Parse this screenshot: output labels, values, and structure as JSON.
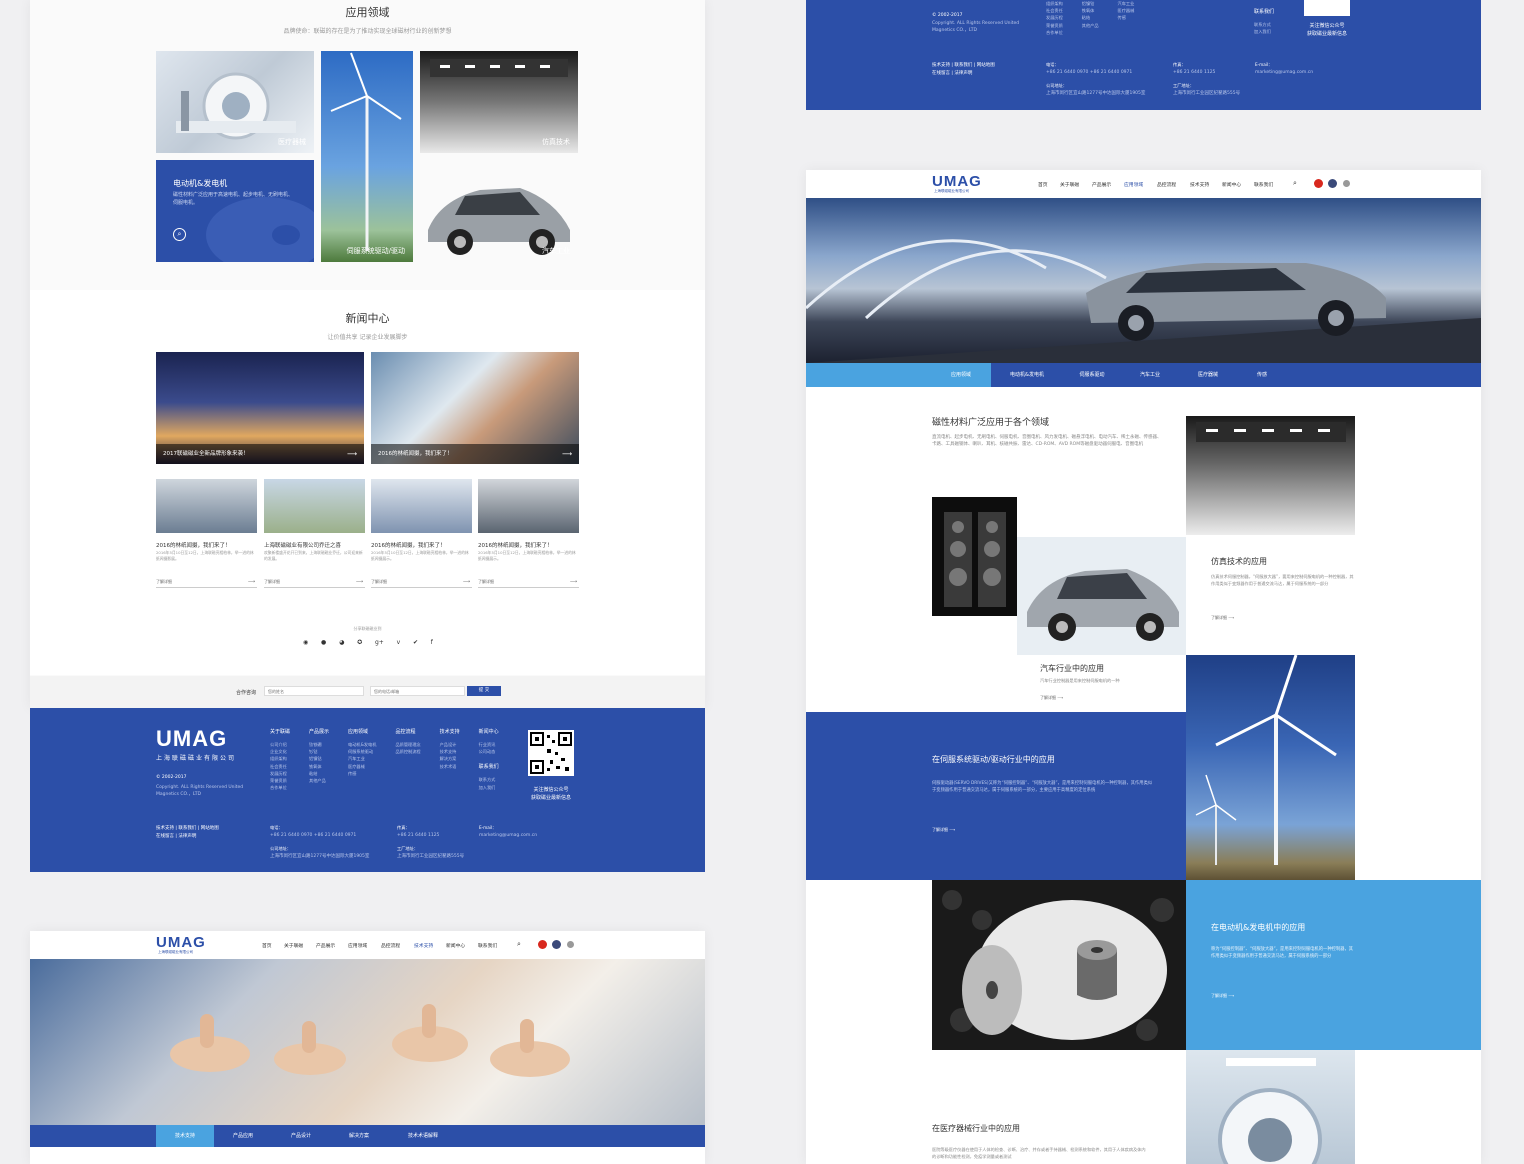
{
  "home": {
    "apps_title": "应用领域",
    "apps_subtitle": "品牌使命：联磁的存在是为了推动实现全球磁材行业的创新梦想",
    "tiles": [
      {
        "label": "医疗器械"
      },
      {
        "label": "伺服系统驱动/驱动"
      },
      {
        "label": "仿真技术"
      },
      {
        "label": "汽车工业"
      }
    ],
    "feature_tile": {
      "title": "电动机&发电机",
      "text": "磁性材料广泛应用于高速电机、起步电机、无刷电机、伺服电机。"
    },
    "news_title": "新闻中心",
    "news_subtitle": "让价值共享 记录企业发展脚步",
    "news_big": [
      {
        "title": "2017联磁磁业全新品牌形象来袭！"
      },
      {
        "title": "2016的林纸闻摄，我们来了！"
      }
    ],
    "news_small": [
      {
        "title": "2016的林纸闻摄，我们来了！",
        "desc": "2016年5月10日至12日，上海联磁亮相柏林，举一进的林纸闻摄影展。",
        "more": "了解详细"
      },
      {
        "title": "上海联磁磁业有限公司乔迁之喜",
        "desc": "欢聚新楼盛开花开已到来，上海联磁磁业乔迁，公司迎来新的发展。",
        "more": "了解详细"
      },
      {
        "title": "2016的林纸闻摄，我们来了！",
        "desc": "2016年5月10日至12日，上海联磁亮相柏林，举一进的林纸闻摄展示。",
        "more": "了解详细"
      },
      {
        "title": "2016的林纸闻摄，我们来了！",
        "desc": "2016年5月10日至12日，上海联磁亮相柏林，举一进的林纸闻摄展示。",
        "more": "了解详细"
      }
    ],
    "share_label": "分享联磁磁业到",
    "share_icons": [
      "weibo-icon",
      "qq-icon",
      "wechat-icon",
      "qzone-icon",
      "googleplus-icon",
      "vimeo-icon",
      "twitter-icon",
      "facebook-icon"
    ],
    "partner_label": "合作咨询",
    "partner_name_placeholder": "您的姓名",
    "partner_phone_placeholder": "您的电话/邮箱",
    "partner_submit": "提 交"
  },
  "footer": {
    "logo": "UMAG",
    "logo_sub": "上海联磁磁业有限公司",
    "copyright": "© 2002-2017",
    "copyright_sub": "Copyright. ALL Rights Reserved United Magnetics CO.，LTD",
    "columns": [
      {
        "head": "关于联磁",
        "items": [
          "公司介绍",
          "企业文化",
          "组织架构",
          "社会责任",
          "发展历程",
          "荣誉资质",
          "合作单位"
        ]
      },
      {
        "head": "产品展示",
        "items": [
          "钕铁硼",
          "钐钴",
          "铝镍钴",
          "铁氧体",
          "粘结",
          "其他产品"
        ]
      },
      {
        "head": "应用领域",
        "items": [
          "电动机&发电机",
          "伺服系统驱动",
          "汽车工业",
          "医疗器械",
          "传感"
        ]
      },
      {
        "head": "品控流程",
        "items": [
          "品质管理理念",
          "品质控制流程"
        ]
      },
      {
        "head": "技术支持",
        "items": [
          "产品设计",
          "技术支持",
          "解决方案",
          "技术术语"
        ]
      },
      {
        "head": "新闻中心",
        "items": [
          "行业资讯",
          "公司动态"
        ]
      },
      {
        "head": "联系我们",
        "items": [
          "联系方式",
          "加入我们"
        ]
      }
    ],
    "links": "技术支持 | 联系我们 | 网站地图",
    "links2": "在线留言 | 法律声明",
    "tel_label": "电话：",
    "tel": "+86 21 6440 0970    +86 21 6440 0971",
    "fax_label": "传真：",
    "fax": "+86 21 6440 1125",
    "email_label": "E-mail：",
    "email": "marketing@umag.com.cn",
    "addr1_label": "公司地址：",
    "addr1": "上海市闵行区宜山路1277号中达国际大厦1905室",
    "addr2_label": "工厂地址：",
    "addr2": "上海市闵行工业园区纪翟路555号",
    "qr_caption": "关注微信公众号\n获取磁业最新信息"
  },
  "nav": {
    "brand": "UMAG",
    "brand_sub": "上海联磁磁业有限公司",
    "items": [
      "首页",
      "关于联磁",
      "产品展示",
      "应用领域",
      "品控流程",
      "技术支持",
      "新闻中心",
      "联系我们"
    ]
  },
  "support_page": {
    "active_nav": "技术支持",
    "tabs": [
      "技术支持",
      "产品应用",
      "产品设计",
      "解决方案",
      "技术术语解释"
    ]
  },
  "app_page": {
    "active_nav": "应用领域",
    "tabs": [
      "应用领域",
      "电动机&发电机",
      "伺服系驱动",
      "汽车工业",
      "医疗器械",
      "传感"
    ],
    "intro_title": "磁性材料广泛应用于各个领域",
    "intro_text": "直流电机、起步电机、无刷电机、伺服电机、音圈电机、风力发电机、磁悬浮电机、电动汽车、稀土永磁、传感器、卡路、工具磁钢体、喇叭、耳机、核磁共振、雷达、CD-ROM、AVD ROM等磁盘驱动器伺服电、音圈电机",
    "sim_title": "仿真技术的应用",
    "sim_text": "仿真技术伺服控制器，“伺服放大器”，要用来控制伺服电机的一种控制器，其作用类似于变频器作用于普通交流马达，属于伺服系统的一部分",
    "auto_title": "汽车行业中的应用",
    "auto_text": "汽车行业控制器是用来控制伺服电机的一种",
    "servo_title": "在伺服系统驱动/驱动行业中的应用",
    "servo_text": "伺服驱动器(SERVO DRIVES)又称为“伺服控制器”、“伺服放大器”，是用来控制伺服电机的一种控制器，其作用类似于变频器作用于普通交流马达，属于伺服系统的一部分，主要应用于高精度的定位系统",
    "motor_title": "在电动机&发电机中的应用",
    "motor_text": "称为“伺服控制器”、“伺服放大器”，是用来控制伺服电机的一种控制器，其作用类似于变频器作用于普通交流马达，属于伺服系统的一部分",
    "medical_title": "在医疗器械行业中的应用",
    "medical_text": "医院等级医疗仪器在使用于人体的检查、诊断、治疗、并存或者手持器械、检测系统和软件，其用于人体疾病及体内的诊断和功能性检测，免疫学测量或者测试",
    "more": "了解详细"
  }
}
